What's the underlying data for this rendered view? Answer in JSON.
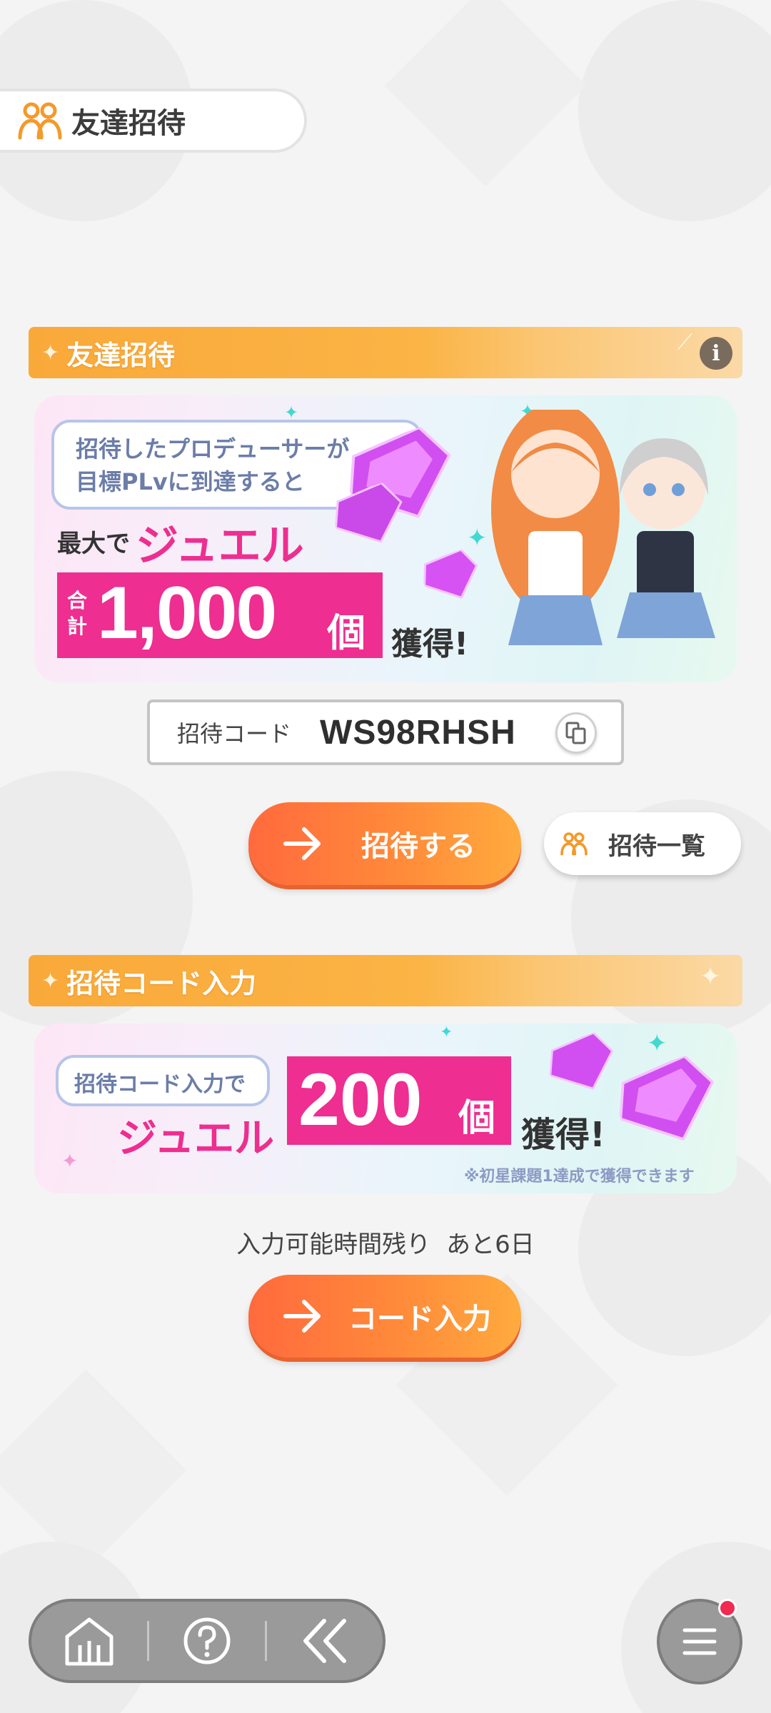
{
  "header": {
    "title": "友達招待",
    "icon": "people-icon"
  },
  "invite_section": {
    "title": "友達招待",
    "info_icon": "info-icon",
    "banner": {
      "bubble_line1": "招待したプロデューサーが",
      "bubble_line2": "目標PLvに到達すると",
      "max_prefix": "最大で",
      "reward_name": "ジュエル",
      "total_label_1": "合",
      "total_label_2": "計",
      "amount": "1,000",
      "unit": "個",
      "obtain": "獲得!"
    },
    "code_label": "招待コード",
    "code_value": "WS98RHSH",
    "copy_icon": "copy-icon",
    "invite_button": "招待する",
    "invite_list_button": "招待一覧"
  },
  "code_input_section": {
    "title": "招待コード入力",
    "banner": {
      "bubble": "招待コード入力で",
      "reward_name": "ジュエル",
      "amount": "200",
      "unit": "個",
      "obtain": "獲得!",
      "note": "※初星課題1達成で獲得できます"
    },
    "remaining_label": "入力可能時間残り",
    "remaining_value": "あと6日",
    "code_input_button": "コード入力"
  },
  "nav": {
    "items": [
      {
        "icon": "home-icon"
      },
      {
        "icon": "help-icon"
      },
      {
        "icon": "back-icon"
      }
    ],
    "menu_icon": "menu-icon",
    "notification_badge": true
  },
  "colors": {
    "accent_orange": "#ff7a3b",
    "jewel_pink": "#ee2e90",
    "section_bar": "#f9a93a"
  }
}
